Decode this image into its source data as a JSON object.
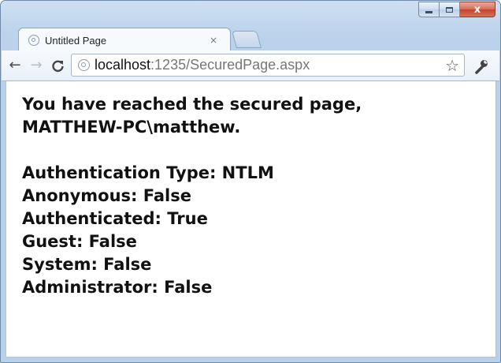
{
  "browser": {
    "tab": {
      "title": "Untitled Page",
      "close_glyph": "×",
      "icon": "page-globe-icon"
    },
    "nav": {
      "back": "←",
      "forward": "→",
      "reload": "C"
    },
    "address": {
      "host": "localhost",
      "rest": ":1235/SecuredPage.aspx",
      "star": "☆"
    },
    "window_buttons": {
      "close": "x"
    }
  },
  "page": {
    "heading_line1": "You have reached the secured page,",
    "heading_line2": "MATTHEW-PC\\matthew.",
    "details": [
      "Authentication Type: NTLM",
      "Anonymous: False",
      "Authenticated: True",
      "Guest: False",
      "System: False",
      "Administrator: False"
    ]
  }
}
